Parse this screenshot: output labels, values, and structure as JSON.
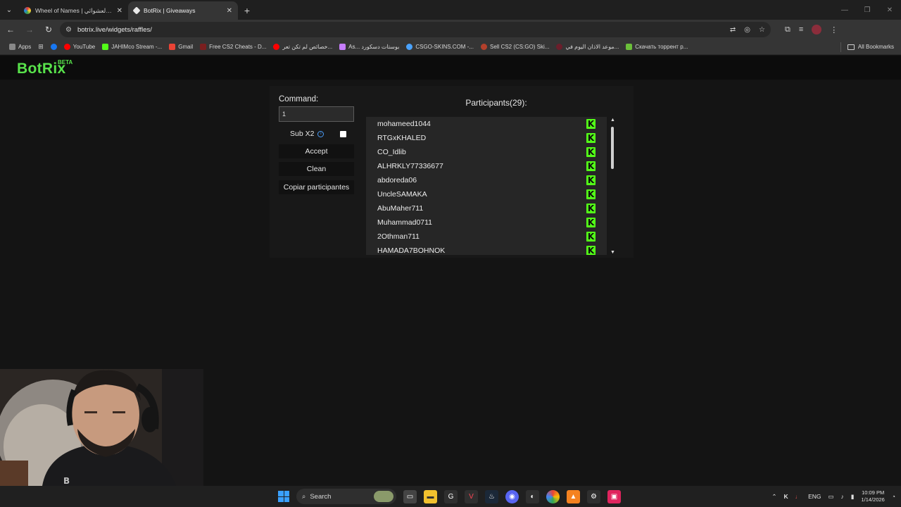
{
  "browser": {
    "tabs": [
      {
        "title": "Wheel of Names | قسم العشوائي",
        "active": false
      },
      {
        "title": "BotRix | Giveaways",
        "active": true
      }
    ],
    "address": "botrix.live/widgets/raffles/"
  },
  "bookmarks": [
    {
      "label": "Apps",
      "color": "#888888"
    },
    {
      "label": "",
      "color": "#1877f2"
    },
    {
      "label": "YouTube",
      "color": "#ff0000"
    },
    {
      "label": "JAHIMco Stream -...",
      "color": "#53fc18"
    },
    {
      "label": "Gmail",
      "color": "#ea4335"
    },
    {
      "label": "Free CS2 Cheats - D...",
      "color": "#7a1f1f"
    },
    {
      "label": "خصائص لم تكن تعر...",
      "color": "#ff0000"
    },
    {
      "label": "As... بوستات دسكورد",
      "color": "#c77dff"
    },
    {
      "label": "CSGO-SKINS.COM -...",
      "color": "#4aa3ff"
    },
    {
      "label": "Sell CS2 (CS:GO) Ski...",
      "color": "#b3402b"
    },
    {
      "label": "موعد الاذان اليوم في...",
      "color": "#6b1e2b"
    },
    {
      "label": "Скачать торрент р...",
      "color": "#6bbf3a"
    }
  ],
  "all_bookmarks_label": "All Bookmarks",
  "site": {
    "logo": "BotRix",
    "beta": "BETA"
  },
  "raffle": {
    "command_label": "Command:",
    "command_value": "1",
    "sub_label": "Sub X2",
    "accept_label": "Accept",
    "clean_label": "Clean",
    "copy_label": "Copiar participantes",
    "participants_title": "Participants(29):",
    "participants": [
      "mohameed1044",
      "RTGxKHALED",
      "CO_Idlib",
      "ALHRKLY77336677",
      "abdoreda06",
      "UncleSAMAKA",
      "AbuMaher711",
      "Muhammad0711",
      "2Othman711",
      "HAMADA7BOHNOK"
    ]
  },
  "taskbar": {
    "search_label": "Search",
    "lang": "ENG",
    "time": "10:09 PM",
    "date": "1/14/2026"
  }
}
